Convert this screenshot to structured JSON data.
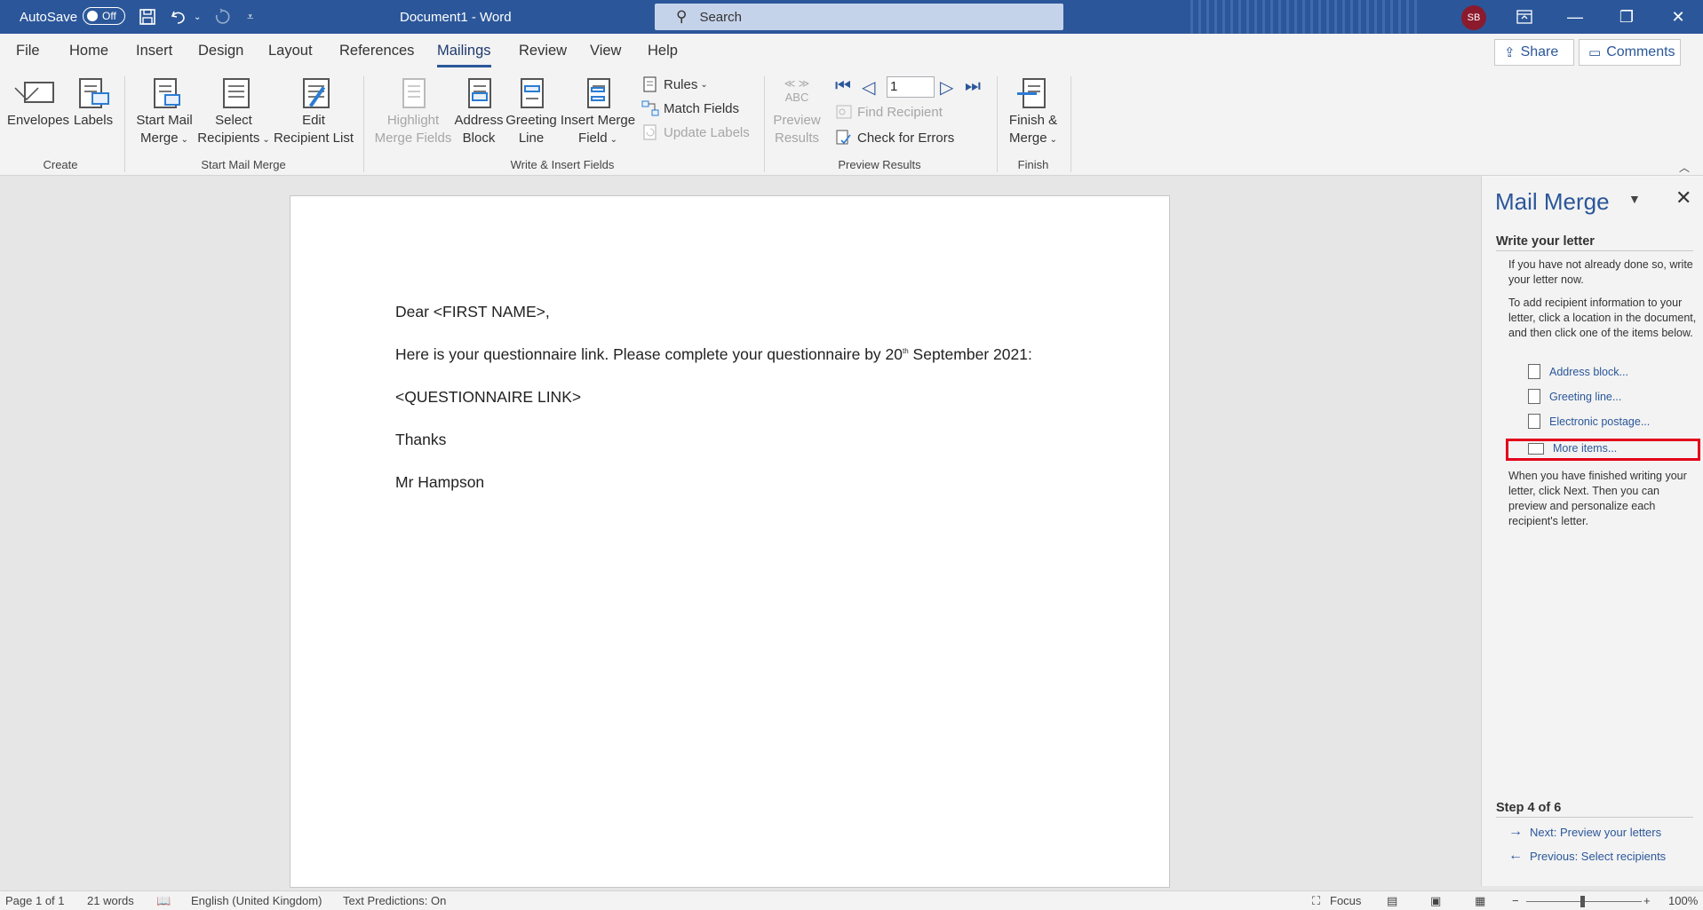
{
  "titlebar": {
    "autosave_label": "AutoSave",
    "autosave_state": "Off",
    "doc_title": "Document1  -  Word",
    "search_placeholder": "Search",
    "avatar_initials": "SB"
  },
  "tabs": [
    "File",
    "Home",
    "Insert",
    "Design",
    "Layout",
    "References",
    "Mailings",
    "Review",
    "View",
    "Help"
  ],
  "active_tab": "Mailings",
  "share_label": "Share",
  "comments_label": "Comments",
  "ribbon": {
    "create": {
      "label": "Create",
      "envelopes": "Envelopes",
      "labels": "Labels"
    },
    "start_mail_merge": {
      "label": "Start Mail Merge",
      "start_l1": "Start Mail",
      "start_l2": "Merge",
      "select_l1": "Select",
      "select_l2": "Recipients",
      "edit_l1": "Edit",
      "edit_l2": "Recipient List"
    },
    "write_insert": {
      "label": "Write & Insert Fields",
      "highlight_l1": "Highlight",
      "highlight_l2": "Merge Fields",
      "address_l1": "Address",
      "address_l2": "Block",
      "greeting_l1": "Greeting",
      "greeting_l2": "Line",
      "insert_l1": "Insert Merge",
      "insert_l2": "Field",
      "rules": "Rules",
      "match_fields": "Match Fields",
      "update_labels": "Update Labels"
    },
    "preview": {
      "label": "Preview Results",
      "abc": "ABC",
      "preview_l1": "Preview",
      "preview_l2": "Results",
      "record": "1",
      "find_recipient": "Find Recipient",
      "check_errors": "Check for Errors"
    },
    "finish": {
      "label": "Finish",
      "finish_l1": "Finish &",
      "finish_l2": "Merge"
    }
  },
  "document": {
    "line1": "Dear <FIRST NAME>,",
    "line2_pre": "Here is your questionnaire link. Please complete your questionnaire by 20",
    "line2_sup": "th",
    "line2_post": " September 2021:",
    "line3": "<QUESTIONNAIRE LINK>",
    "line4": "Thanks",
    "line5": "Mr Hampson"
  },
  "pane": {
    "title": "Mail Merge",
    "heading": "Write your letter",
    "p1": "If you have not already done so, write your letter now.",
    "p2": "To add recipient information to your letter, click a location in the document, and then click one of the items below.",
    "links": [
      "Address block...",
      "Greeting line...",
      "Electronic postage...",
      "More items..."
    ],
    "p3": "When you have finished writing your letter, click Next. Then you can preview and personalize each recipient's letter.",
    "step": "Step 4 of 6",
    "next": "Next: Preview your letters",
    "previous": "Previous: Select recipients"
  },
  "status": {
    "page": "Page 1 of 1",
    "words": "21 words",
    "language": "English (United Kingdom)",
    "predictions": "Text Predictions: On",
    "focus": "Focus",
    "zoom": "100%"
  }
}
